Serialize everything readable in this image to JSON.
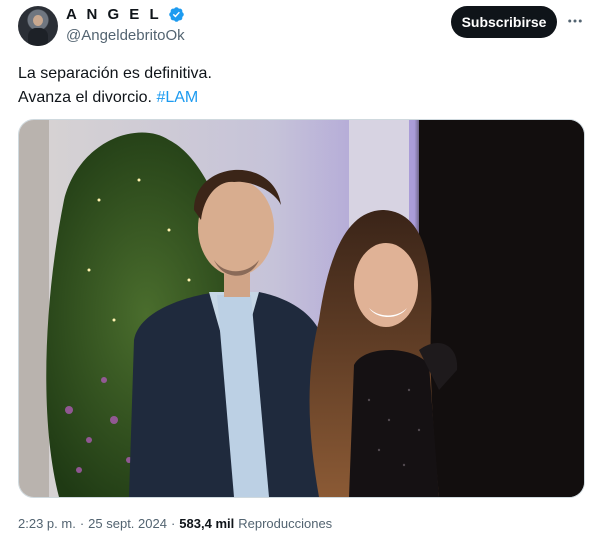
{
  "account": {
    "name": "A N G E L",
    "handle": "@AngeldebritoOk",
    "avatar_icon": "profile-photo",
    "verified_icon": "verified-badge-icon",
    "verified_color": "#1d9bf0"
  },
  "actions": {
    "subscribe_label": "Subscribirse",
    "more_icon": "more-horizontal-icon"
  },
  "tweet": {
    "line1": "La separación es definitiva.",
    "line2_text": "Avanza el divorcio. ",
    "hashtag": "#LAM"
  },
  "meta": {
    "time": "2:23 p. m.",
    "separator": " · ",
    "date": "25 sept. 2024",
    "separator2": " · ",
    "views_count": "583,4 mil",
    "views_label": "Reproducciones"
  },
  "colors": {
    "accent": "#1d9bf0",
    "button_bg": "#0f1419",
    "secondary_text": "#536471"
  }
}
